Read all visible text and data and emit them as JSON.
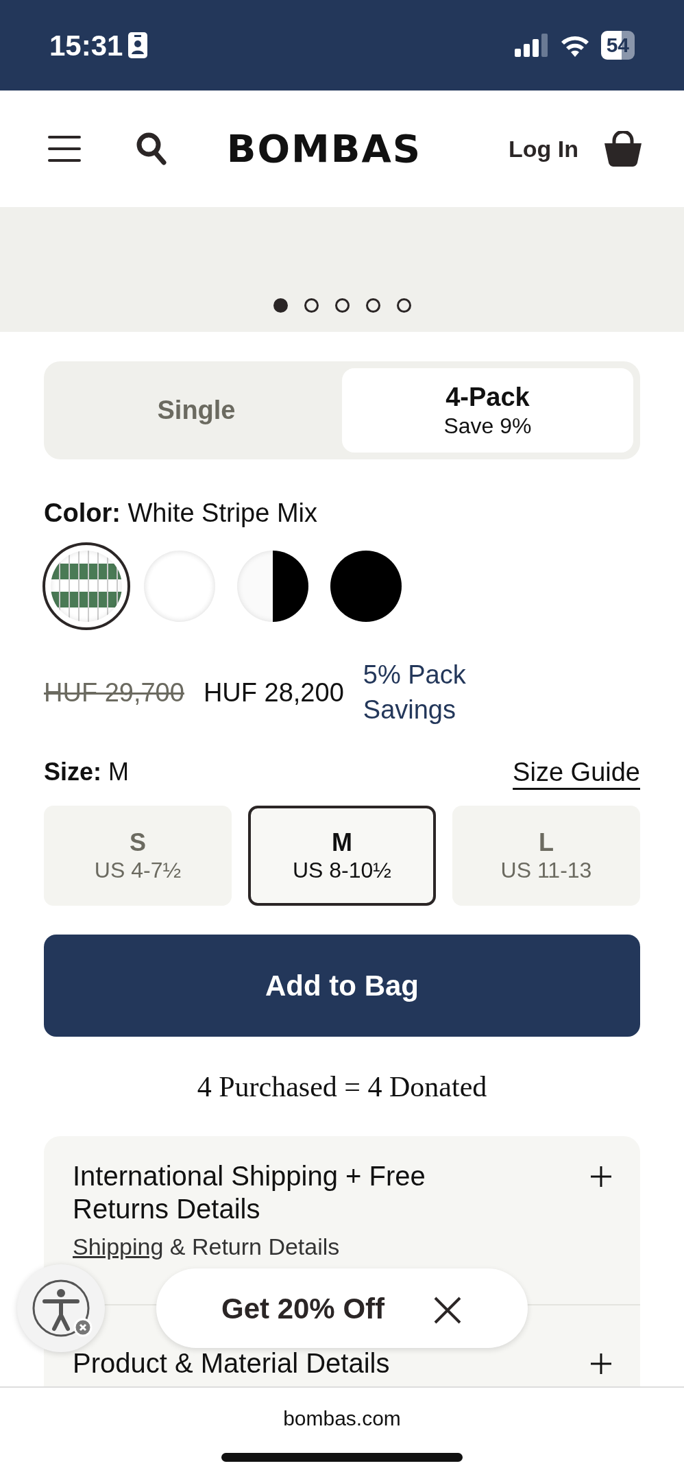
{
  "status_bar": {
    "time": "15:31",
    "battery": "54"
  },
  "header": {
    "logo": "BOMBAS",
    "login": "Log In"
  },
  "gallery": {
    "dots": [
      {
        "selected": true
      },
      {
        "selected": false
      },
      {
        "selected": false
      },
      {
        "selected": false
      },
      {
        "selected": false
      }
    ]
  },
  "pack_options": [
    {
      "label": "Single",
      "selected": false
    },
    {
      "label": "4-Pack",
      "sub": "Save 9%",
      "selected": true
    }
  ],
  "color": {
    "label": "Color:",
    "value": "White Stripe Mix",
    "swatches": [
      {
        "kind": "stripe",
        "selected": true
      },
      {
        "kind": "white",
        "selected": false
      },
      {
        "kind": "half",
        "selected": false
      },
      {
        "kind": "black",
        "selected": false
      }
    ]
  },
  "price": {
    "original": "HUF 29,700",
    "current": "HUF 28,200",
    "savings": "5% Pack Savings"
  },
  "size": {
    "label": "Size:",
    "value": "M",
    "guide": "Size Guide",
    "options": [
      {
        "label": "S",
        "range": "US 4-7½",
        "selected": false
      },
      {
        "label": "M",
        "range": "US 8-10½",
        "selected": true
      },
      {
        "label": "L",
        "range": "US 11-13",
        "selected": false
      }
    ]
  },
  "add_button": "Add to Bag",
  "donation": "4 Purchased = 4 Donated",
  "accordion": [
    {
      "title": "International Shipping + Free Returns Details",
      "link": "Shipping",
      "rest": "& Return Details",
      "expanded": false
    },
    {
      "title": "Product & Material Details",
      "expanded": false
    }
  ],
  "promo": {
    "label": "Get 20% Off"
  },
  "browser": {
    "address": "bombas.com"
  }
}
